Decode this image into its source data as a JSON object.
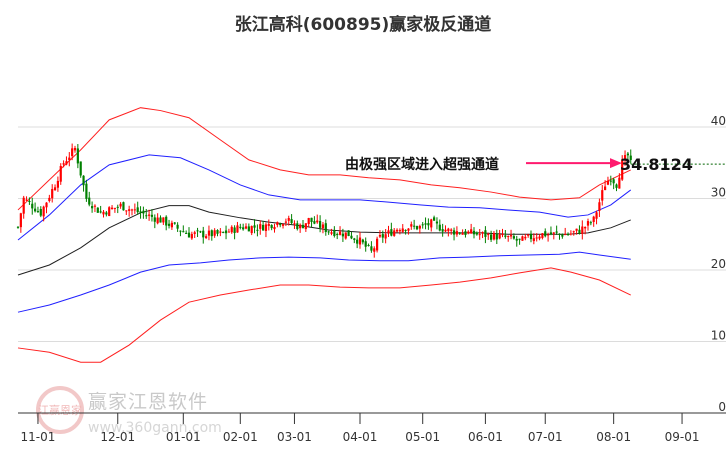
{
  "chart_data": {
    "type": "candlestick-with-bands",
    "title": "张江高科(600895)赢家极反通道",
    "ylim": [
      0,
      45
    ],
    "yticks": [
      0,
      10,
      20,
      30,
      40
    ],
    "xticks": [
      {
        "label": "11-01",
        "i": 7
      },
      {
        "label": "12-01",
        "i": 35
      },
      {
        "label": "01-01",
        "i": 58
      },
      {
        "label": "02-01",
        "i": 78
      },
      {
        "label": "03-01",
        "i": 97
      },
      {
        "label": "04-01",
        "i": 120
      },
      {
        "label": "05-01",
        "i": 142
      },
      {
        "label": "06-01",
        "i": 164
      },
      {
        "label": "07-01",
        "i": 185
      },
      {
        "label": "08-01",
        "i": 209
      },
      {
        "label": "09-01",
        "i": 233
      }
    ],
    "bands": [
      {
        "name": "outer-upper",
        "color": "#ff2020",
        "points": [
          [
            0,
            28.4
          ],
          [
            11,
            32.6
          ],
          [
            22,
            36.8
          ],
          [
            32,
            41
          ],
          [
            43,
            42.7
          ],
          [
            50,
            42.3
          ],
          [
            60,
            41.3
          ],
          [
            71,
            38.2
          ],
          [
            81,
            35.4
          ],
          [
            92,
            34
          ],
          [
            102,
            33.3
          ],
          [
            113,
            33.3
          ],
          [
            123,
            32.9
          ],
          [
            134,
            32.6
          ],
          [
            145,
            31.9
          ],
          [
            155,
            31.5
          ],
          [
            166,
            30.9
          ],
          [
            176,
            30.2
          ],
          [
            187,
            29.8
          ],
          [
            197,
            30.1
          ],
          [
            204,
            31.9
          ],
          [
            215,
            34
          ]
        ]
      },
      {
        "name": "inner-upper",
        "color": "#2020ff",
        "points": [
          [
            0,
            24.2
          ],
          [
            11,
            27.7
          ],
          [
            22,
            31.9
          ],
          [
            32,
            34.7
          ],
          [
            46,
            36.1
          ],
          [
            57,
            35.7
          ],
          [
            67,
            34
          ],
          [
            78,
            31.9
          ],
          [
            88,
            30.5
          ],
          [
            99,
            29.8
          ],
          [
            109,
            29.8
          ],
          [
            120,
            29.8
          ],
          [
            130,
            29.5
          ],
          [
            141,
            29.1
          ],
          [
            151,
            28.8
          ],
          [
            162,
            28.7
          ],
          [
            172,
            28.4
          ],
          [
            183,
            28.1
          ],
          [
            193,
            27.4
          ],
          [
            200,
            27.7
          ],
          [
            208,
            29.1
          ],
          [
            215,
            31.2
          ]
        ]
      },
      {
        "name": "middle",
        "color": "#202020",
        "points": [
          [
            0,
            19.3
          ],
          [
            11,
            20.7
          ],
          [
            22,
            23.1
          ],
          [
            32,
            25.9
          ],
          [
            43,
            28
          ],
          [
            53,
            29
          ],
          [
            60,
            29
          ],
          [
            67,
            28.1
          ],
          [
            78,
            27.3
          ],
          [
            88,
            26.7
          ],
          [
            99,
            26.2
          ],
          [
            109,
            25.6
          ],
          [
            120,
            25.3
          ],
          [
            130,
            25.2
          ],
          [
            141,
            25.2
          ],
          [
            151,
            25.2
          ],
          [
            162,
            25.2
          ],
          [
            172,
            25
          ],
          [
            183,
            25
          ],
          [
            193,
            25
          ],
          [
            200,
            25.2
          ],
          [
            208,
            25.9
          ],
          [
            215,
            27
          ]
        ]
      },
      {
        "name": "inner-lower",
        "color": "#2020ff",
        "points": [
          [
            0,
            14.1
          ],
          [
            11,
            15.1
          ],
          [
            22,
            16.5
          ],
          [
            32,
            17.9
          ],
          [
            43,
            19.7
          ],
          [
            53,
            20.7
          ],
          [
            64,
            21
          ],
          [
            74,
            21.4
          ],
          [
            85,
            21.7
          ],
          [
            95,
            21.8
          ],
          [
            106,
            21.7
          ],
          [
            116,
            21.4
          ],
          [
            127,
            21.3
          ],
          [
            137,
            21.3
          ],
          [
            148,
            21.7
          ],
          [
            158,
            21.8
          ],
          [
            169,
            22
          ],
          [
            179,
            22.1
          ],
          [
            190,
            22.2
          ],
          [
            197,
            22.5
          ],
          [
            204,
            22.1
          ],
          [
            215,
            21.5
          ]
        ]
      },
      {
        "name": "outer-lower",
        "color": "#ff2020",
        "points": [
          [
            0,
            9.1
          ],
          [
            11,
            8.5
          ],
          [
            22,
            7.1
          ],
          [
            29,
            7.1
          ],
          [
            39,
            9.5
          ],
          [
            50,
            13
          ],
          [
            60,
            15.5
          ],
          [
            71,
            16.5
          ],
          [
            81,
            17.2
          ],
          [
            92,
            17.9
          ],
          [
            102,
            17.9
          ],
          [
            113,
            17.6
          ],
          [
            123,
            17.5
          ],
          [
            134,
            17.5
          ],
          [
            145,
            17.9
          ],
          [
            155,
            18.3
          ],
          [
            166,
            18.9
          ],
          [
            176,
            19.6
          ],
          [
            187,
            20.3
          ],
          [
            194,
            19.7
          ],
          [
            204,
            18.6
          ],
          [
            215,
            16.5
          ]
        ]
      }
    ],
    "close_path": [
      [
        0,
        26
      ],
      [
        2,
        30
      ],
      [
        8,
        28
      ],
      [
        13,
        32
      ],
      [
        16,
        35
      ],
      [
        20,
        37
      ],
      [
        24,
        30
      ],
      [
        29,
        28
      ],
      [
        36,
        29
      ],
      [
        43,
        28
      ],
      [
        50,
        27
      ],
      [
        60,
        25
      ],
      [
        71,
        25
      ],
      [
        78,
        26
      ],
      [
        85,
        26
      ],
      [
        94,
        27
      ],
      [
        99,
        26
      ],
      [
        102,
        27
      ],
      [
        109,
        25.5
      ],
      [
        116,
        25
      ],
      [
        120,
        24
      ],
      [
        124,
        22.5
      ],
      [
        127,
        24.5
      ],
      [
        134,
        26
      ],
      [
        141,
        26
      ],
      [
        145,
        26.5
      ],
      [
        151,
        25.5
      ],
      [
        162,
        25
      ],
      [
        172,
        24.5
      ],
      [
        176,
        24
      ],
      [
        183,
        25
      ],
      [
        193,
        25
      ],
      [
        197,
        25.5
      ],
      [
        202,
        27
      ],
      [
        206,
        32
      ],
      [
        208,
        33
      ],
      [
        210,
        32
      ],
      [
        212,
        35
      ],
      [
        214,
        36
      ],
      [
        215,
        34.8
      ]
    ],
    "last_value": "34.8124",
    "annotation": "由极强区域进入超强通道",
    "colors": {
      "up": "#ff0000",
      "down": "#008000",
      "arrow": "#ff1a6e"
    }
  },
  "watermark": {
    "name": "赢家江恩软件",
    "url": "www.360gann.com",
    "seal": "江赢恩家"
  }
}
